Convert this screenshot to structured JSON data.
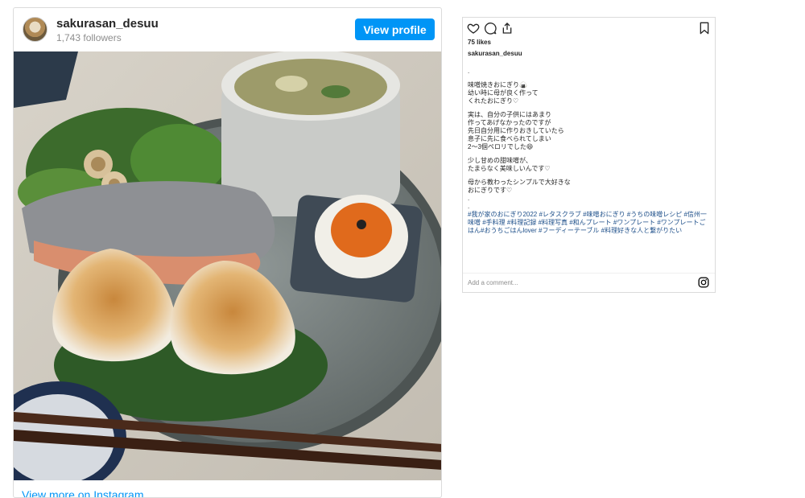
{
  "profile": {
    "username": "sakurasan_desuu",
    "followers": "1,743 followers",
    "view_profile_label": "View profile",
    "view_more_label": "View more on Instagram"
  },
  "post": {
    "likes": "75 likes",
    "caption_user": "sakurasan_desuu",
    "caption_lines": [
      ".",
      "",
      "味噌焼きおにぎり🍙",
      "幼い時に母が良く作って",
      "くれたおにぎり♡",
      "",
      "実は、自分の子供にはあまり",
      "作ってあげなかったのですが",
      "先日自分用に作りおきしていたら",
      "息子に先に食べられてしまい",
      "2〜3個ペロリでした😄",
      "",
      "少し甘めの甜味噌が、",
      "たまらなく美味しいんです♡",
      "",
      "母から教わったシンプルで大好きな",
      "おにぎりです♡",
      ".",
      "."
    ],
    "hashtags": "#我が家のおにぎり2022 #レタスクラブ #味噌おにぎり #うちの味噌レシピ #信州一味噌 #手料理 #料理記録 #料理写真 #和んプレート #ワンプレート #ワンプレートごはん#おうちごはんlover #フーディーテーブル #料理好きな人と繋がりたい",
    "comment_placeholder": "Add a comment..."
  },
  "icons": {
    "like": "heart-icon",
    "comment": "comment-icon",
    "share": "share-icon",
    "save": "bookmark-icon",
    "instagram": "instagram-icon"
  },
  "colors": {
    "accent": "#0095f6",
    "hashtag": "#1c4e89",
    "muted": "#8e8e8e"
  }
}
